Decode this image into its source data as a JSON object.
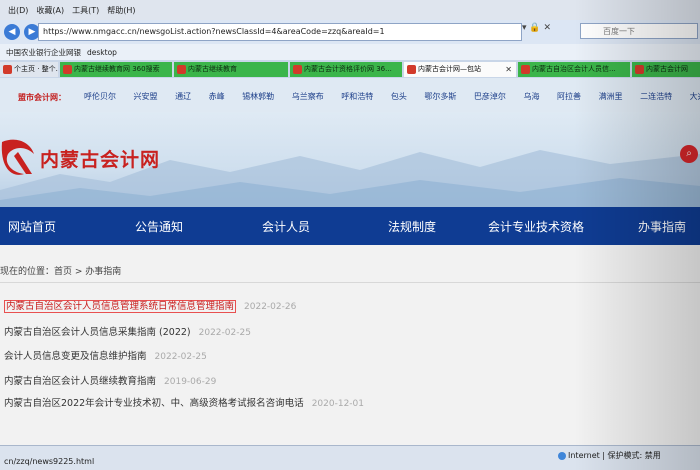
{
  "browser": {
    "menu": [
      "出(D)",
      "收藏(A)",
      "工具(T)",
      "帮助(H)"
    ],
    "address": "https://www.nmgacc.cn/newsgoList.action?newsClassId=4&areaCode=zzq&areaId=1",
    "search_placeholder": "百度一下",
    "favorites": [
      "中国农业银行企业网银",
      "desktop"
    ],
    "tabs": [
      "个主页 · 整个...",
      "内蒙古继续教育网 360搜索",
      "内蒙古继续教育",
      "内蒙古会计资格评价网 36...",
      "内蒙古会计网—包站",
      "内蒙古自治区会计人员信...",
      "内蒙古会计网"
    ],
    "status_url": "cn/zzq/news9225.html",
    "status_zone": "Internet | 保护模式: 禁用"
  },
  "site": {
    "city_label": "盟市会计网：",
    "cities": [
      "呼伦贝尔",
      "兴安盟",
      "通辽",
      "赤峰",
      "锡林郭勒",
      "乌兰察布",
      "呼和浩特",
      "包头",
      "鄂尔多斯",
      "巴彦淖尔",
      "乌海",
      "阿拉善",
      "满洲里",
      "二连浩特",
      "大兴安"
    ],
    "logo_text": "内蒙古会计网",
    "nav": [
      "网站首页",
      "公告通知",
      "会计人员",
      "法规制度",
      "会计专业技术资格",
      "办事指南"
    ]
  },
  "content": {
    "breadcrumb": "现在的位置：首页 > 办事指南",
    "items": [
      {
        "title": "内蒙古自治区会计人员信息管理系统日常信息管理指南",
        "date": "2022-02-26"
      },
      {
        "title": "内蒙古自治区会计人员信息采集指南 (2022)",
        "date": "2022-02-25"
      },
      {
        "title": "会计人员信息变更及信息维护指南",
        "date": "2022-02-25"
      },
      {
        "title": "内蒙古自治区会计人员继续教育指南",
        "date": "2019-06-29"
      },
      {
        "title": "内蒙古自治区2022年会计专业技术初、中、高级资格考试报名咨询电话",
        "date": "2020-12-01"
      }
    ]
  },
  "colors": {
    "brand_red": "#c8211f",
    "nav_blue": "#0f3c93",
    "tab_green": "#3bb54a"
  },
  "icons": [
    "back-icon",
    "forward-icon",
    "search-icon",
    "site-logo-icon",
    "globe-icon"
  ]
}
